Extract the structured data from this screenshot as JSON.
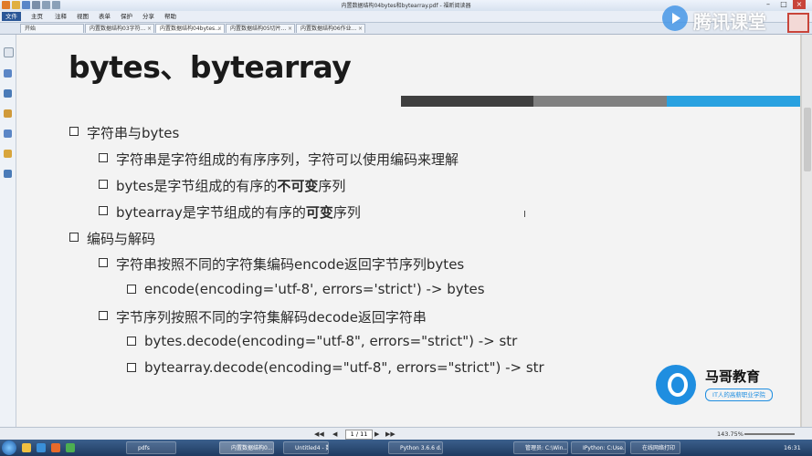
{
  "window": {
    "title": "内置数据结构04bytes和bytearray.pdf - 福昕阅读器"
  },
  "ribbon": [
    "文件",
    "主页",
    "注释",
    "视图",
    "表单",
    "保护",
    "分享",
    "帮助"
  ],
  "tabs": [
    {
      "label": "开始"
    },
    {
      "label": "内置数据结构03字符..."
    },
    {
      "label": "内置数据结构04bytes..."
    },
    {
      "label": "内置数据结构05切片..."
    },
    {
      "label": "内置数据结构06作业..."
    }
  ],
  "watermark": "腾讯课堂",
  "slide": {
    "title": "bytes、bytearray",
    "lines": [
      {
        "parts": [
          {
            "t": "字符串与bytes"
          }
        ]
      },
      {
        "parts": [
          {
            "t": "字符串是字符组成的有序序列，字符可以使用编码来理解"
          }
        ]
      },
      {
        "parts": [
          {
            "t": "bytes是字节组成的有序的"
          },
          {
            "t": "不可变",
            "b": true
          },
          {
            "t": "序列"
          }
        ]
      },
      {
        "parts": [
          {
            "t": "bytearray是字节组成的有序的"
          },
          {
            "t": "可变",
            "b": true
          },
          {
            "t": "序列"
          }
        ]
      },
      {
        "parts": [
          {
            "t": "编码与解码"
          }
        ]
      },
      {
        "parts": [
          {
            "t": "字符串按照不同的字符集编码encode返回字节序列bytes"
          }
        ]
      },
      {
        "parts": [
          {
            "t": "encode(encoding='utf-8', errors='strict') -> bytes"
          }
        ]
      },
      {
        "parts": [
          {
            "t": "字节序列按照不同的字符集解码decode返回字符串"
          }
        ]
      },
      {
        "parts": [
          {
            "t": "bytes.decode(encoding=\"utf-8\", errors=\"strict\") -> str"
          }
        ]
      },
      {
        "parts": [
          {
            "t": "bytearray.decode(encoding=\"utf-8\", errors=\"strict\") -> str"
          }
        ]
      }
    ],
    "logo_name": "马哥教育",
    "logo_slogan": "IT人的高薪职业学院"
  },
  "status": {
    "page": "1 / 11",
    "zoom": "143.75%"
  },
  "taskbar": {
    "items": [
      "pdfs",
      "内置数据结构0...",
      "Untitled4 - 数...",
      "Python 3.6.6 d...",
      "管理员: C:\\Win...",
      "IPython: C:Use...",
      "在线网络打印"
    ],
    "time": "16:31"
  },
  "colors": {
    "accent_blue": "#29a1e0",
    "bar_dark": "#3f3f3f",
    "bar_gray": "#808080"
  }
}
